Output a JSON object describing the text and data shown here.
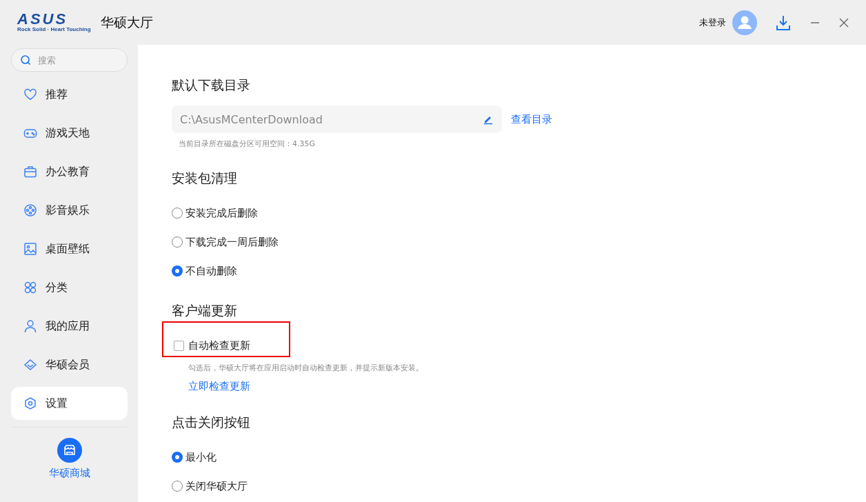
{
  "window": {
    "logo": {
      "wordmark": "ASUS",
      "tagline": "Rock Solid · Heart Touching"
    },
    "title": "华硕大厅",
    "login_label": "未登录"
  },
  "sidebar": {
    "search": {
      "placeholder": "搜索"
    },
    "items": [
      {
        "label": "推荐",
        "selected": false
      },
      {
        "label": "游戏天地",
        "selected": false
      },
      {
        "label": "办公教育",
        "selected": false
      },
      {
        "label": "影音娱乐",
        "selected": false
      },
      {
        "label": "桌面壁纸",
        "selected": false
      },
      {
        "label": "分类",
        "selected": false
      },
      {
        "label": "我的应用",
        "selected": false
      },
      {
        "label": "华硕会员",
        "selected": false
      },
      {
        "label": "设置",
        "selected": true
      }
    ],
    "store": {
      "label": "华硕商城"
    }
  },
  "settings": [
    {
      "kind": "folder",
      "title": "默认下载目录",
      "path": "C:\\AsusMCenterDownload",
      "link": "查看目录",
      "hint": "当前目录所在磁盘分区可用空间：4.35G"
    },
    {
      "kind": "radios",
      "title": "安装包清理",
      "options": [
        {
          "label": "安装完成后删除",
          "selected": false
        },
        {
          "label": "下载完成一周后删除",
          "selected": false
        },
        {
          "label": "不自动删除",
          "selected": true
        }
      ]
    },
    {
      "kind": "checkbox",
      "title": "客户端更新",
      "label": "自动检查更新",
      "checked": false,
      "highlighted": true,
      "hint": "勾选后，华硕大厅将在应用启动时自动检查更新，并提示新版本安装。",
      "link": "立即检查更新"
    },
    {
      "kind": "radios",
      "title": "点击关闭按钮",
      "options": [
        {
          "label": "最小化",
          "selected": true
        },
        {
          "label": "关闭华硕大厅",
          "selected": false
        }
      ]
    }
  ]
}
